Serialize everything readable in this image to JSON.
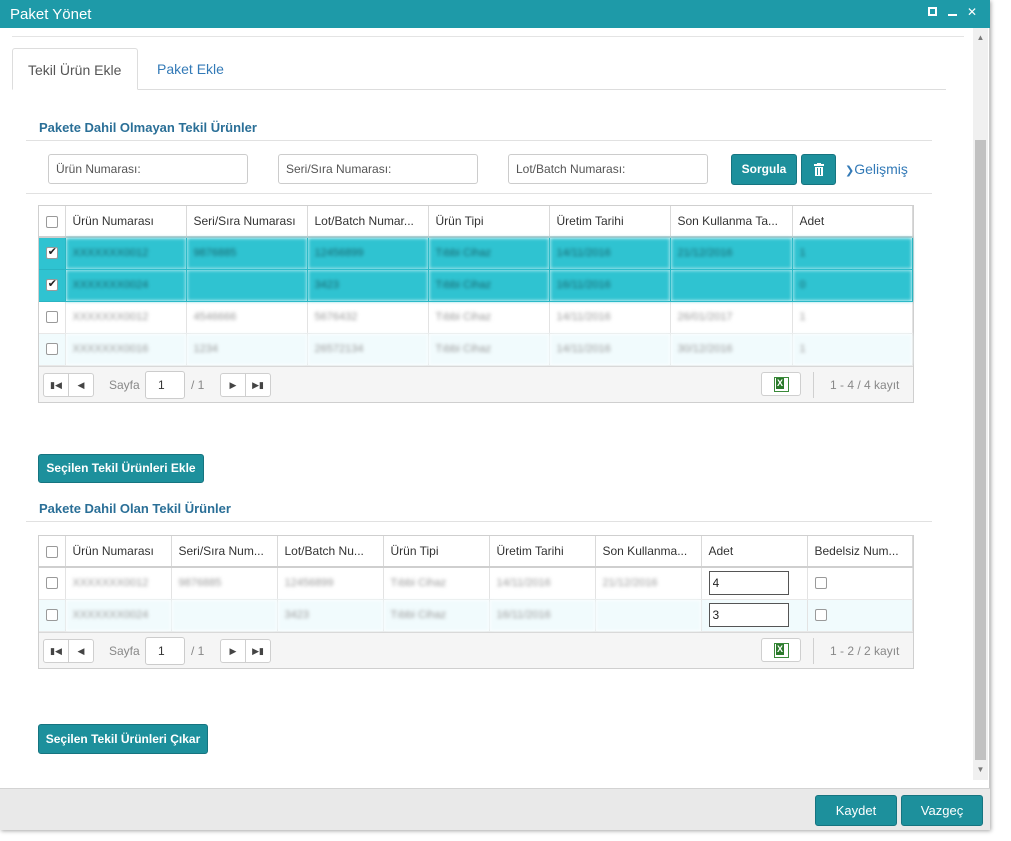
{
  "window": {
    "title": "Paket Yönet"
  },
  "tabs": [
    {
      "label": "Tekil Ürün Ekle",
      "active": true
    },
    {
      "label": "Paket Ekle",
      "active": false
    }
  ],
  "section_excluded": {
    "title": "Pakete Dahil Olmayan Tekil Ürünler",
    "filters": {
      "urun_no_placeholder": "Ürün Numarası:",
      "seri_no_placeholder": "Seri/Sıra Numarası:",
      "lot_no_placeholder": "Lot/Batch Numarası:"
    },
    "query_button": "Sorgula",
    "delete_icon": "trash-icon",
    "advanced_label": "Gelişmiş",
    "columns": [
      "Ürün Numarası",
      "Seri/Sıra Numarası",
      "Lot/Batch Numar...",
      "Ürün Tipi",
      "Üretim Tarihi",
      "Son Kullanma Ta...",
      "Adet"
    ],
    "rows": [
      {
        "checked": true,
        "selected": true,
        "cells": [
          "XXXXXXX0012",
          "9876885",
          "12456899",
          "Tıbbi Cihaz",
          "14/11/2016",
          "21/12/2016",
          "1"
        ]
      },
      {
        "checked": true,
        "selected": true,
        "cells": [
          "XXXXXXX0024",
          "",
          "3423",
          "Tıbbi Cihaz",
          "16/11/2016",
          "",
          "0"
        ]
      },
      {
        "checked": false,
        "selected": false,
        "cells": [
          "XXXXXXX0012",
          "4546666",
          "5676432",
          "Tıbbi Cihaz",
          "14/11/2016",
          "26/01/2017",
          "1"
        ]
      },
      {
        "checked": false,
        "selected": false,
        "cells": [
          "XXXXXXX0016",
          "1234",
          "26572134",
          "Tıbbi Cihaz",
          "14/11/2016",
          "30/12/2016",
          "1"
        ]
      }
    ],
    "pager": {
      "label": "Sayfa",
      "page": "1",
      "total": "/ 1",
      "count": "1 - 4 / 4 kayıt"
    },
    "add_button": "Seçilen Tekil Ürünleri Ekle"
  },
  "section_included": {
    "title": "Pakete Dahil Olan Tekil Ürünler",
    "columns": [
      "Ürün Numarası",
      "Seri/Sıra Num...",
      "Lot/Batch Nu...",
      "Ürün Tipi",
      "Üretim Tarihi",
      "Son Kullanma...",
      "Adet",
      "Bedelsiz Num..."
    ],
    "rows": [
      {
        "checked": false,
        "cells": [
          "XXXXXXX0012",
          "9876885",
          "12456899",
          "Tıbbi Cihaz",
          "14/11/2016",
          "21/12/2016"
        ],
        "qty": "4",
        "free": false
      },
      {
        "checked": false,
        "cells": [
          "XXXXXXX0024",
          "",
          "3423",
          "Tıbbi Cihaz",
          "16/11/2016",
          ""
        ],
        "qty": "3",
        "free": false
      }
    ],
    "pager": {
      "label": "Sayfa",
      "page": "1",
      "total": "/ 1",
      "count": "1 - 2 / 2 kayıt"
    },
    "remove_button": "Seçilen Tekil Ürünleri Çıkar"
  },
  "footer": {
    "save_label": "Kaydet",
    "cancel_label": "Vazgeç"
  },
  "colors": {
    "titlebar": "#1e9aa8",
    "selected_row": "#2fc3d1",
    "button": "#1d909c",
    "link": "#337ab7"
  }
}
